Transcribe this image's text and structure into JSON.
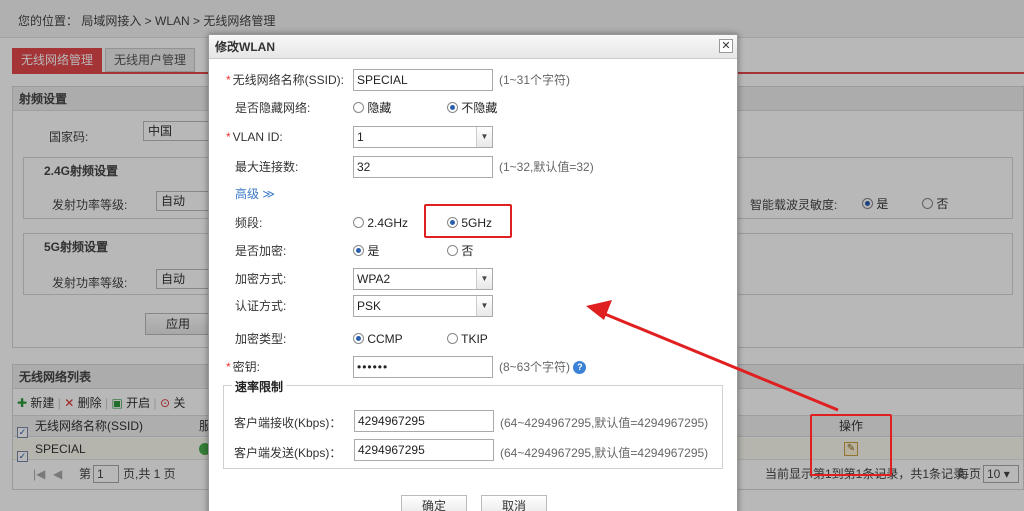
{
  "breadcrumb": "您的位置：  局域网接入 > WLAN > 无线网络管理",
  "tabs": [
    "无线网络管理",
    "无线用户管理"
  ],
  "rf_panel": {
    "title": "射频设置",
    "country_label": "国家码:",
    "country_value": "中国",
    "g24_title": "2.4G射频设置",
    "power_label": "发射功率等级:",
    "power_value": "自动",
    "g5_title": "5G射频设置",
    "power5_label": "发射功率等级:",
    "power5_value": "自动",
    "apply_button": "应用",
    "sensitivity_label": "智能载波灵敏度:",
    "sens_yes": "是",
    "sens_no": "否"
  },
  "list_panel": {
    "title": "无线网络列表",
    "toolbar": {
      "new": "新建",
      "delete": "删除",
      "enable": "开启",
      "disable": "关"
    },
    "col_ssid": "无线网络名称(SSID)",
    "col_service": "服",
    "col_action": "操作",
    "row_ssid": "SPECIAL",
    "pager": {
      "first": "第",
      "page": "1",
      "total": "页,共 1 页",
      "status": "当前显示第1到第1条记录，共1条记录",
      "per_page": "每页",
      "per_page_value": "10"
    }
  },
  "modal": {
    "title": "修改WLAN",
    "close": "✕",
    "ssid_label": "无线网络名称(SSID):",
    "ssid_value": "SPECIAL",
    "ssid_hint": "(1~31个字符)",
    "hide_label": "是否隐藏网络:",
    "hide_opt1": "隐藏",
    "hide_opt2": "不隐藏",
    "vlan_label": "VLAN ID:",
    "vlan_value": "1",
    "maxconn_label": "最大连接数:",
    "maxconn_value": "32",
    "maxconn_hint": "(1~32,默认值=32)",
    "advanced": "高级 ≫",
    "band_label": "频段:",
    "band_opt1": "2.4GHz",
    "band_opt2": "5GHz",
    "encrypt_label": "是否加密:",
    "encrypt_yes": "是",
    "encrypt_no": "否",
    "enc_method_label": "加密方式:",
    "enc_method_value": "WPA2",
    "auth_label": "认证方式:",
    "auth_value": "PSK",
    "enc_type_label": "加密类型:",
    "enc_type_opt1": "CCMP",
    "enc_type_opt2": "TKIP",
    "key_label": "密钥:",
    "key_value": "••••••",
    "key_hint": "(8~63个字符)",
    "rate_title": "速率限制",
    "rx_label": "客户端接收(Kbps)：",
    "rx_value": "4294967295",
    "rx_hint": "(64~4294967295,默认值=4294967295)",
    "tx_label": "客户端发送(Kbps)：",
    "tx_value": "4294967295",
    "tx_hint": "(64~4294967295,默认值=4294967295)",
    "ok_button": "确定",
    "cancel_button": "取消"
  },
  "colors": {
    "accent": "#e5484d",
    "annotation": "#e02020"
  }
}
